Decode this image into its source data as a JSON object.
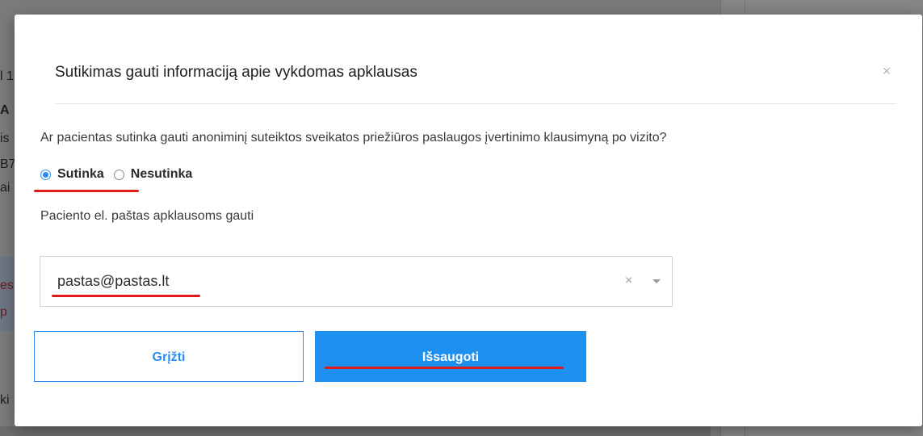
{
  "background": {
    "fragments": [
      "l 1",
      "A",
      "is",
      "B7",
      "ai",
      "es",
      "p",
      "ki"
    ]
  },
  "modal": {
    "title": "Sutikimas gauti informaciją apie vykdomas apklausas",
    "close_symbol": "×",
    "question": "Ar pacientas sutinka gauti anoniminį suteiktos sveikatos priežiūros paslaugos įvertinimo klausimyną po vizito?",
    "consent_options": [
      {
        "label": "Sutinka",
        "selected": true
      },
      {
        "label": "Nesutinka",
        "selected": false
      }
    ],
    "email_label": "Paciento el. paštas apklausoms gauti",
    "email_select": {
      "value": "pastas@pastas.lt",
      "clear_symbol": "×"
    },
    "buttons": {
      "back_label": "Grįžti",
      "save_label": "Išsaugoti"
    }
  },
  "colors": {
    "accent": "#1e90f0",
    "annotation": "#e01b1b"
  }
}
